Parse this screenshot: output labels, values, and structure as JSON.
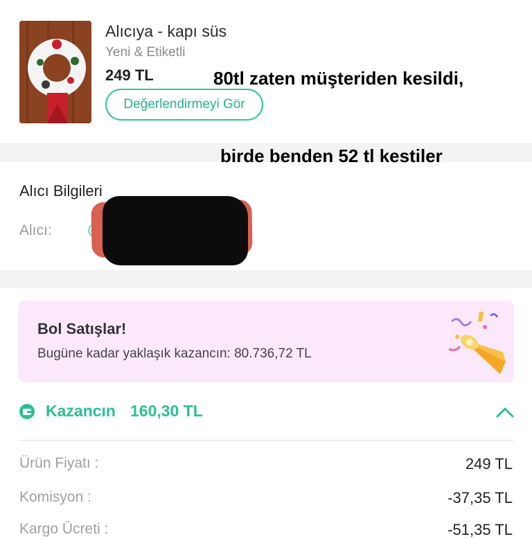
{
  "product": {
    "title": "Alıcıya - kapı süs",
    "condition": "Yeni & Etiketli",
    "price": "249 TL",
    "review_button": "Değerlendirmeyi Gör"
  },
  "notes": {
    "line1": "80tl zaten müşteriden kesildi,",
    "line2": "birde benden 52 tl kestiler"
  },
  "buyer": {
    "heading": "Alıcı Bilgileri",
    "label": "Alıcı:",
    "handle_prefix": "@"
  },
  "promo": {
    "title": "Bol Satışlar!",
    "subtitle": "Bugüne kadar yaklaşık kazancın: 80.736,72 TL"
  },
  "earnings": {
    "label": "Kazancın",
    "amount": "160,30 TL",
    "rows": [
      {
        "label": "Ürün Fiyatı :",
        "value": "249 TL"
      },
      {
        "label": "Komisyon :",
        "value": "-37,35 TL"
      },
      {
        "label": "Kargo Ücreti :",
        "value": "-51,35 TL"
      }
    ]
  },
  "colors": {
    "accent": "#2bc59a",
    "promo_bg": "#fbe9fb",
    "section_gap": "#f3f3f3"
  }
}
